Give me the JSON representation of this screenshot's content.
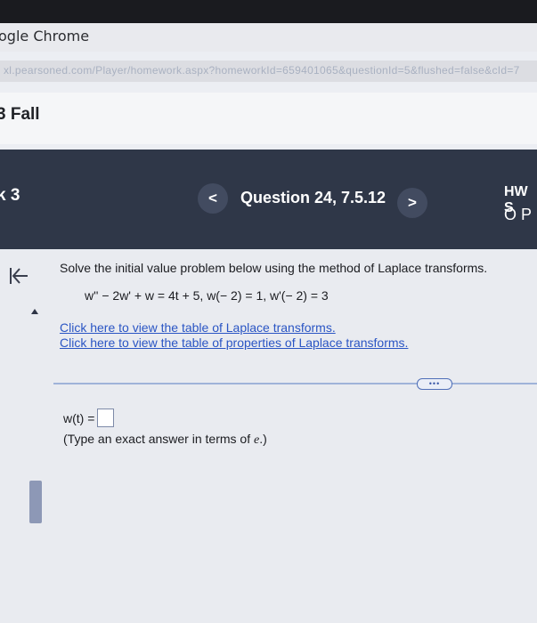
{
  "browser": {
    "app_name": "ogle Chrome",
    "url": "xl.pearsoned.com/Player/homework.aspx?homeworkId=659401065&questionId=5&flushed=false&cId=7"
  },
  "course": {
    "name": "3 Fall"
  },
  "question_bar": {
    "left_label": "k 3",
    "prev_label": "<",
    "title": "Question 24, 7.5.12",
    "next_label": ">",
    "hw_label": "HW S",
    "hw_score": "O P"
  },
  "question": {
    "prompt": "Solve the initial value problem below using the method of Laplace transforms.",
    "equation": "w'' − 2w' + w = 4t + 5,  w(− 2) = 1,  w'(− 2) = 3",
    "link_transforms": "Click here to view the table of Laplace transforms.",
    "link_properties": "Click here to view the table of properties of Laplace transforms.",
    "more_label": "•••",
    "answer_label": "w(t) =",
    "answer_value": "",
    "hint_prefix": "(Type an exact answer in terms of ",
    "hint_symbol": "e",
    "hint_suffix": ".)"
  },
  "icons": {
    "back": "collapse-left-icon",
    "side_arrow": "triangle-up-icon"
  },
  "colors": {
    "question_bar": "#2f3748",
    "link": "#2a55c4",
    "divider": "#9fb3d9"
  }
}
